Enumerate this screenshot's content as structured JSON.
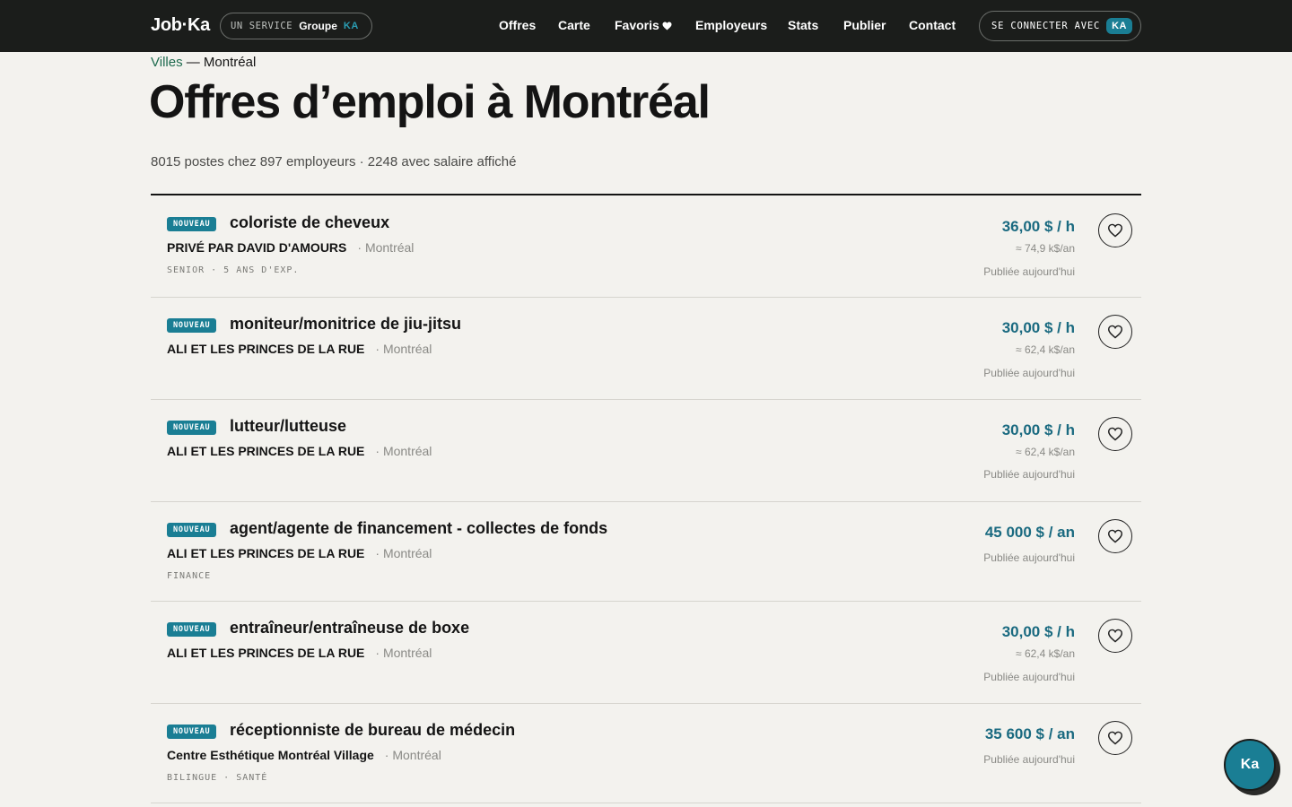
{
  "header": {
    "logo": "Job·Ka",
    "service": {
      "prefix": "UN SERVICE",
      "group": "Groupe",
      "ka": "KA"
    },
    "nav": [
      "Offres",
      "Carte",
      "Favoris",
      "Employeurs",
      "Stats",
      "Publier",
      "Contact"
    ],
    "favoris_icon": "heart-icon",
    "connect": {
      "label": "SE CONNECTER AVEC",
      "badge": "KA"
    }
  },
  "breadcrumb": {
    "parent": "Villes",
    "separator": " — ",
    "current": "Montréal"
  },
  "page_title": "Offres d’emploi à Montréal",
  "summary": "8015 postes chez 897 employeurs · 2248 avec salaire affiché",
  "jobs": [
    {
      "badge": "NOUVEAU",
      "title": "coloriste de cheveux",
      "employer": "PRIVÉ PAR DAVID D'AMOURS",
      "location": "· Montréal",
      "tags": "SENIOR · 5 ANS D'EXP.",
      "salary": "36,00 $ / h",
      "annual": "≈ 74,9 k$/an",
      "posted": "Publiée aujourd'hui"
    },
    {
      "badge": "NOUVEAU",
      "title": "moniteur/monitrice de jiu-jitsu",
      "employer": "ALI ET LES PRINCES DE LA RUE",
      "location": "· Montréal",
      "tags": "",
      "salary": "30,00 $ / h",
      "annual": "≈ 62,4 k$/an",
      "posted": "Publiée aujourd'hui"
    },
    {
      "badge": "NOUVEAU",
      "title": "lutteur/lutteuse",
      "employer": "ALI ET LES PRINCES DE LA RUE",
      "location": "· Montréal",
      "tags": "",
      "salary": "30,00 $ / h",
      "annual": "≈ 62,4 k$/an",
      "posted": "Publiée aujourd'hui"
    },
    {
      "badge": "NOUVEAU",
      "title": "agent/agente de financement - collectes de fonds",
      "employer": "ALI ET LES PRINCES DE LA RUE",
      "location": "· Montréal",
      "tags": "FINANCE",
      "salary": "45 000 $ / an",
      "annual": "",
      "posted": "Publiée aujourd'hui"
    },
    {
      "badge": "NOUVEAU",
      "title": "entraîneur/entraîneuse de boxe",
      "employer": "ALI ET LES PRINCES DE LA RUE",
      "location": "· Montréal",
      "tags": "",
      "salary": "30,00 $ / h",
      "annual": "≈ 62,4 k$/an",
      "posted": "Publiée aujourd'hui"
    },
    {
      "badge": "NOUVEAU",
      "title": "réceptionniste de bureau de médecin",
      "employer": "Centre Esthétique Montréal Village",
      "location": "· Montréal",
      "tags": "BILINGUE · SANTÉ",
      "salary": "35 600 $ / an",
      "annual": "",
      "posted": "Publiée aujourd'hui"
    }
  ],
  "favorite_icon": "heart-outline-icon",
  "chat_widget": {
    "label": "Ka"
  },
  "colors": {
    "accent": "#1a7e94",
    "salary": "#1a6a80",
    "topbar": "#1b1d1b",
    "background": "#f3f2ee",
    "breadcrumb_link": "#1f6b4f"
  }
}
